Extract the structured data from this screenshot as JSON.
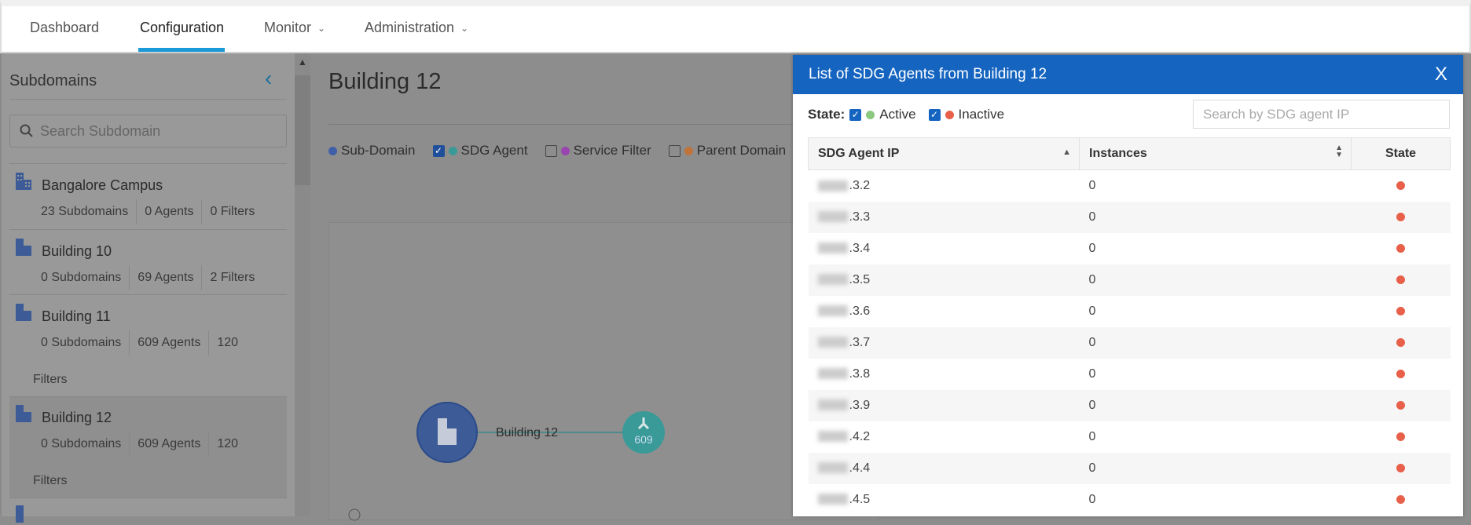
{
  "nav": {
    "tabs": [
      {
        "label": "Dashboard"
      },
      {
        "label": "Configuration",
        "active": true
      },
      {
        "label": "Monitor",
        "dropdown": true
      },
      {
        "label": "Administration",
        "dropdown": true
      }
    ]
  },
  "sidebar": {
    "title": "Subdomains",
    "search_placeholder": "Search Subdomain",
    "items": [
      {
        "name": "Bangalore Campus",
        "subdomains": "23 Subdomains",
        "agents": "0 Agents",
        "filters": "0 Filters"
      },
      {
        "name": "Building 10",
        "subdomains": "0 Subdomains",
        "agents": "69 Agents",
        "filters": "2 Filters"
      },
      {
        "name": "Building 11",
        "subdomains": "0 Subdomains",
        "agents": "609 Agents",
        "filters": "120",
        "filters_wrap": "Filters"
      },
      {
        "name": "Building 12",
        "subdomains": "0 Subdomains",
        "agents": "609 Agents",
        "filters": "120",
        "filters_wrap": "Filters",
        "selected": true
      }
    ]
  },
  "main": {
    "title": "Building 12",
    "legend": [
      {
        "label": "Sub-Domain",
        "color": "#3f5fa8"
      },
      {
        "label": "SDG Agent",
        "color": "#3a9a98",
        "checked": true
      },
      {
        "label": "Service Filter",
        "color": "#9a44b0",
        "checked": false
      },
      {
        "label": "Parent Domain",
        "color": "#c0733a",
        "checked": false
      }
    ],
    "graph": {
      "domain_label": "Building 12",
      "agent_count": "609"
    }
  },
  "modal": {
    "title": "List of SDG Agents from Building 12",
    "close": "X",
    "state_label": "State:",
    "active_label": "Active",
    "inactive_label": "Inactive",
    "active_color": "#8bc97f",
    "inactive_color": "#e8604a",
    "search_placeholder": "Search by SDG agent IP",
    "columns": [
      "SDG Agent IP",
      "Instances",
      "State"
    ],
    "rows": [
      {
        "ip": ".3.2",
        "instances": "0",
        "state": "inactive"
      },
      {
        "ip": ".3.3",
        "instances": "0",
        "state": "inactive"
      },
      {
        "ip": ".3.4",
        "instances": "0",
        "state": "inactive"
      },
      {
        "ip": ".3.5",
        "instances": "0",
        "state": "inactive"
      },
      {
        "ip": ".3.6",
        "instances": "0",
        "state": "inactive"
      },
      {
        "ip": ".3.7",
        "instances": "0",
        "state": "inactive"
      },
      {
        "ip": ".3.8",
        "instances": "0",
        "state": "inactive"
      },
      {
        "ip": ".3.9",
        "instances": "0",
        "state": "inactive"
      },
      {
        "ip": ".4.2",
        "instances": "0",
        "state": "inactive"
      },
      {
        "ip": ".4.4",
        "instances": "0",
        "state": "inactive"
      },
      {
        "ip": ".4.5",
        "instances": "0",
        "state": "inactive"
      }
    ]
  }
}
